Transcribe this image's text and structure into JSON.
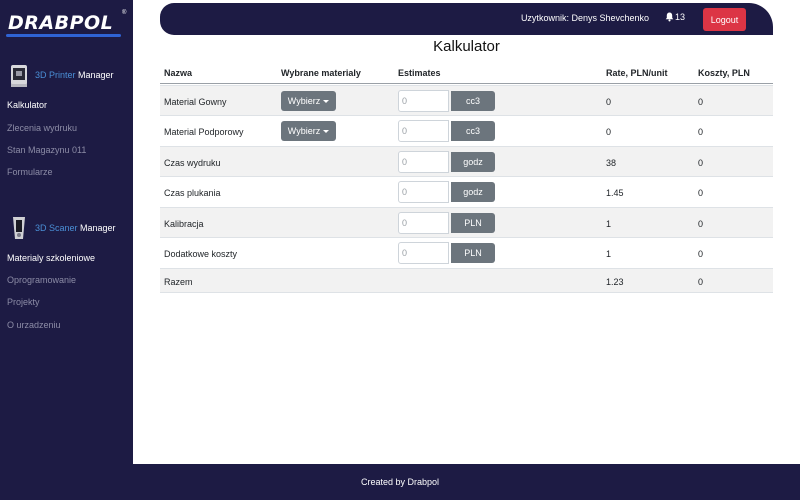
{
  "brand": {
    "logo_text": "DRABPOL",
    "reg_mark": "®"
  },
  "sidebar": {
    "printer_manager": {
      "highlight": "3D Printer",
      "rest": " Manager"
    },
    "printer_items": [
      {
        "label": "Kalkulator",
        "active": true
      },
      {
        "label": "Zlecenia wydruku",
        "active": false
      },
      {
        "label": "Stan Magazynu 011",
        "active": false
      },
      {
        "label": "Formularze",
        "active": false
      }
    ],
    "scanner_manager": {
      "highlight": "3D Scaner",
      "rest": " Manager"
    },
    "scanner_items": [
      {
        "label": "Materialy szkoleniowe",
        "active": true
      },
      {
        "label": "Oprogramowanie",
        "active": false
      },
      {
        "label": "Projekty",
        "active": false
      },
      {
        "label": "O urzadzeniu",
        "active": false
      }
    ]
  },
  "header": {
    "user_label": "Uzytkownik: Denys Shevchenko",
    "notifications_count": "13",
    "logout_label": "Logout"
  },
  "page": {
    "title": "Kalkulator"
  },
  "table": {
    "headers": [
      "Nazwa",
      "Wybrane materialy",
      "Estimates",
      "Rate, PLN/unit",
      "Koszty, PLN"
    ],
    "dropdown_label": "Wybierz",
    "input_placeholder": "0",
    "rows": [
      {
        "name": "Material Gowny",
        "has_dropdown": true,
        "unit": "cc3",
        "rate": "0",
        "cost": "0"
      },
      {
        "name": "Material Podporowy",
        "has_dropdown": true,
        "unit": "cc3",
        "rate": "0",
        "cost": "0"
      },
      {
        "name": "Czas wydruku",
        "has_dropdown": false,
        "unit": "godz",
        "rate": "38",
        "cost": "0"
      },
      {
        "name": "Czas plukania",
        "has_dropdown": false,
        "unit": "godz",
        "rate": "1.45",
        "cost": "0"
      },
      {
        "name": "Kalibracja",
        "has_dropdown": false,
        "unit": "PLN",
        "rate": "1",
        "cost": "0"
      },
      {
        "name": "Dodatkowe koszty",
        "has_dropdown": false,
        "unit": "PLN",
        "rate": "1",
        "cost": "0"
      }
    ],
    "total": {
      "name": "Razem",
      "rate": "1.23",
      "cost": "0"
    }
  },
  "footer": {
    "text": "Created by Drabpol"
  },
  "colors": {
    "navy": "#1d1b44",
    "accent_blue": "#4a8fd6",
    "logout_red": "#dc3545",
    "button_gray": "#6c757d"
  }
}
